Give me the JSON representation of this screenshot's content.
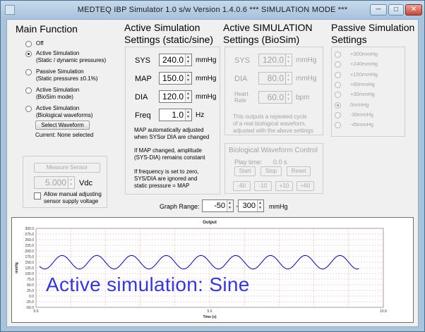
{
  "window": {
    "title": "MEDTEQ IBP Simulator  1.0    s/w Version 1.4.0.6     *** SIMULATION MODE ***",
    "minimize_label": "─",
    "maximize_label": "□",
    "close_label": "✕"
  },
  "main_function": {
    "heading": "Main Function",
    "options": [
      {
        "label": "Off",
        "selected": false
      },
      {
        "label": "Active Simulation\n(Static / dynamic pressures)",
        "selected": true
      },
      {
        "label": "Passive Simulation\n(Static pressures ±0.1%)",
        "selected": false
      },
      {
        "label": "Active Simulation\n(BioSim mode)",
        "selected": false
      },
      {
        "label": "Active Simulation\n(Biological waveforms)",
        "selected": false
      }
    ],
    "select_waveform_label": "Select Waveform",
    "current_label": "Current: None selected"
  },
  "sensor": {
    "measure_button_label": "Measure Sensor",
    "voltage_value": "5.000",
    "voltage_unit": "Vdc",
    "allow_label": "Allow manual adjusting\nsensor supply voltage"
  },
  "active_static": {
    "heading": "Active Simulation\nSettings (static/sine)",
    "fields": [
      {
        "label": "SYS",
        "value": "240.0",
        "unit": "mmHg"
      },
      {
        "label": "MAP",
        "value": "150.0",
        "unit": "mmHg"
      },
      {
        "label": "DIA",
        "value": "120.0",
        "unit": "mmHg"
      },
      {
        "label": "Freq",
        "value": "1.0",
        "unit": "Hz"
      }
    ],
    "notes": [
      "MAP automatically adjusted\nwhen SYSor DIA are changed",
      "If MAP changed, amplitude\n(SYS-DIA) remains constant",
      "If frequency is set to zero,\nSYS/DIA are ignored and\nstatic pressure = MAP"
    ]
  },
  "biosim": {
    "heading": "Active SIMULATION\nSettings (BioSim)",
    "fields": [
      {
        "label": "SYS",
        "value": "120.0",
        "unit": "mmHg"
      },
      {
        "label": "DIA",
        "value": "80.0",
        "unit": "mmHg"
      },
      {
        "label": "Heart\nRate",
        "value": "60.0",
        "unit": "bpm"
      }
    ],
    "note": "This outputs a repeated cycle\nof a real biological waveform,\nadjusted with the above settings",
    "control": {
      "title": "Biological Waveform Control",
      "play_time_label": "Play time:",
      "play_time_value": "0.0 s",
      "buttons": [
        "Start",
        "Stop",
        "Reset"
      ],
      "step_buttons": [
        "-60",
        "-10",
        "+10",
        "+60"
      ]
    }
  },
  "passive": {
    "heading": "Passive Simulation\nSettings",
    "options": [
      {
        "label": "+300mmHg",
        "selected": false
      },
      {
        "label": "+240mmHg",
        "selected": false
      },
      {
        "label": "+150mmHg",
        "selected": false
      },
      {
        "label": "+60mmHg",
        "selected": false
      },
      {
        "label": "+30mmHg",
        "selected": false
      },
      {
        "label": "0mmHg",
        "selected": true
      },
      {
        "label": "-30mmHg",
        "selected": false
      },
      {
        "label": "-45mmHg",
        "selected": false
      }
    ]
  },
  "graph_range": {
    "label": "Graph Range:",
    "min": "-50",
    "separator": "~",
    "max": "300",
    "unit": "mmHg"
  },
  "overlay_caption": "Active simulation: Sine",
  "chart_data": {
    "type": "line",
    "title": "Output",
    "xlabel": "Time (s)",
    "ylabel": "mmHg",
    "xlim": [
      0,
      10
    ],
    "ylim": [
      -50,
      300
    ],
    "x_ticks": [
      "0.0",
      "5.0",
      "10.0"
    ],
    "y_ticks": [
      "300.0",
      "275.0",
      "250.0",
      "225.0",
      "200.0",
      "175.0",
      "150.0",
      "125.0",
      "100.0",
      "75.0",
      "50.0",
      "25.0",
      "0.0",
      "-25.0",
      "-50.0"
    ],
    "grid": true,
    "series": [
      {
        "color": "#1a1aa8",
        "function": "sine",
        "mean": 150,
        "amplitude": 30,
        "frequency_hz": 1.0,
        "phase_deg": 180,
        "x_start": 0.1,
        "x_end": 9.3
      }
    ]
  }
}
